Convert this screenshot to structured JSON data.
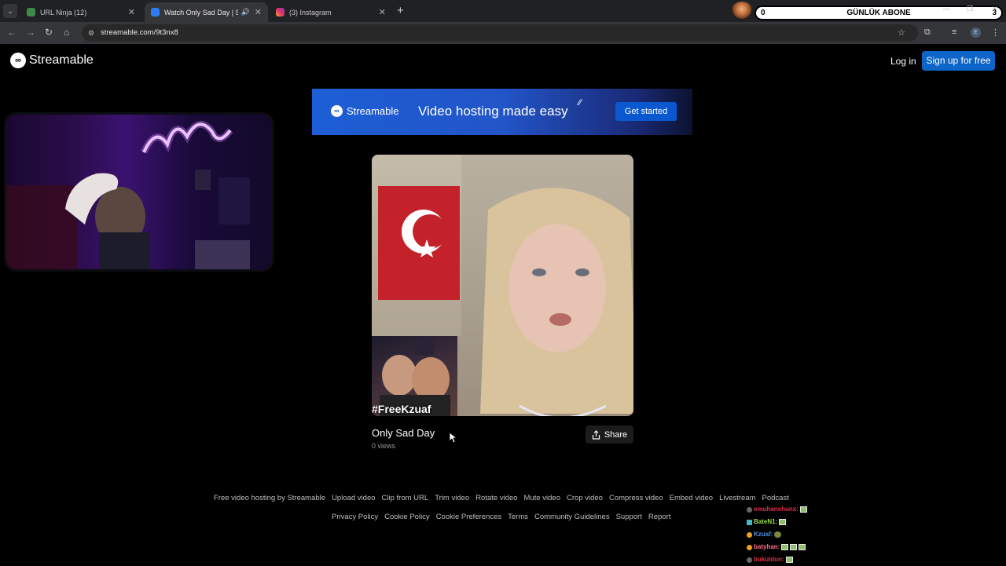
{
  "browser": {
    "tabs": [
      {
        "title": "URL Ninja (12)",
        "active": false,
        "icon": "url-ninja-icon"
      },
      {
        "title": "Watch Only Sad Day | Streamable",
        "active": true,
        "icon": "streamable-icon",
        "audio": true
      },
      {
        "title": "(3) Instagram",
        "active": false,
        "icon": "instagram-icon"
      }
    ],
    "new_tab": "+",
    "url": "streamable.com/9t3nx8",
    "profile_initial": "E"
  },
  "stream_overlay": {
    "count_left": "0",
    "label": "GÜNLÜK ABONE",
    "count_right": "3"
  },
  "header": {
    "brand": "Streamable",
    "login": "Log in",
    "signup": "Sign up for free"
  },
  "banner": {
    "brand": "Streamable",
    "tagline": "Video hosting made easy",
    "cta": "Get started"
  },
  "video": {
    "hashtag": "#FreeKzuaf",
    "title": "Only Sad Day",
    "views": "0 views",
    "share": "Share"
  },
  "footer": {
    "row1": [
      "Free video hosting by Streamable",
      "Upload video",
      "Clip from URL",
      "Trim video",
      "Rotate video",
      "Mute video",
      "Crop video",
      "Compress video",
      "Embed video",
      "Livestream",
      "Podcast"
    ],
    "row2": [
      "Privacy Policy",
      "Cookie Policy",
      "Cookie Preferences",
      "Terms",
      "Community Guidelines",
      "Support",
      "Report"
    ]
  },
  "chat": [
    {
      "user": "emuhanshunx:",
      "color": "#e0304a",
      "emotes": 1
    },
    {
      "user": "BateN1:",
      "color": "#9adf4a",
      "emotes": 1
    },
    {
      "user": "Kzuaf:",
      "color": "#4a90e2",
      "emotes": 1
    },
    {
      "user": "batyhan:",
      "color": "#ff6e8a",
      "emotes": 3
    },
    {
      "user": "bukuldun:",
      "color": "#e0304a",
      "emotes": 1
    }
  ],
  "colors": {
    "accent": "#0e65c9",
    "page_bg": "#000000",
    "flag_red": "#c3222a"
  }
}
